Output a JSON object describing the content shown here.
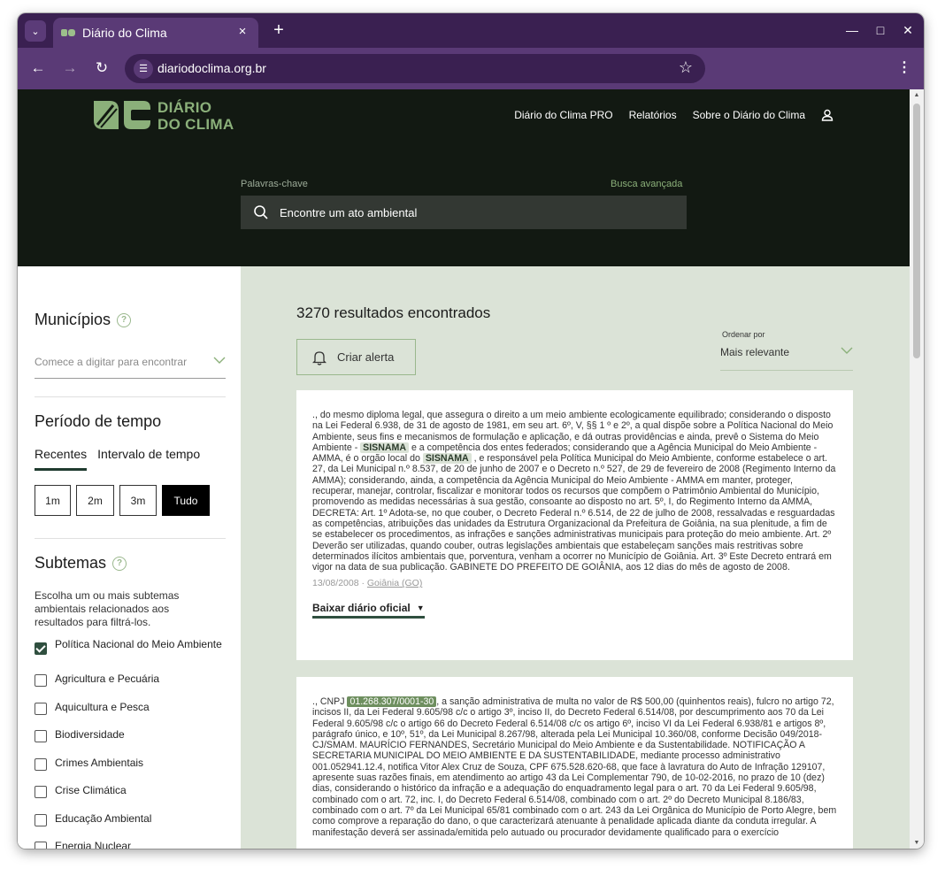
{
  "browser": {
    "tab_title": "Diário do Clima",
    "url": "diariodoclima.org.br",
    "new_tab": "+",
    "close_tab": "×"
  },
  "site": {
    "logo_line1": "DIÁRIO",
    "logo_line2": "DO CLIMA",
    "nav": {
      "pro": "Diário do Clima PRO",
      "reports": "Relatórios",
      "about": "Sobre o Diário do Clima"
    },
    "search": {
      "label": "Palavras-chave",
      "advanced": "Busca avançada",
      "placeholder": "Encontre um ato ambiental"
    }
  },
  "sidebar": {
    "municipios": {
      "title": "Municípios",
      "placeholder": "Comece a digitar para encontrar"
    },
    "periodo": {
      "title": "Período de tempo",
      "tab_recent": "Recentes",
      "tab_interval": "Intervalo de tempo",
      "buttons": [
        "1m",
        "2m",
        "3m",
        "Tudo"
      ],
      "active": "Tudo"
    },
    "subtemas": {
      "title": "Subtemas",
      "description": "Escolha um ou mais subtemas ambientais relacionados aos resultados para filtrá-los.",
      "items": [
        {
          "label": "Política Nacional do Meio Ambiente",
          "checked": true
        },
        {
          "label": "Agricultura e Pecuária",
          "checked": false
        },
        {
          "label": "Aquicultura e Pesca",
          "checked": false
        },
        {
          "label": "Biodiversidade",
          "checked": false
        },
        {
          "label": "Crimes Ambientais",
          "checked": false
        },
        {
          "label": "Crise Climática",
          "checked": false
        },
        {
          "label": "Educação Ambiental",
          "checked": false
        },
        {
          "label": "Energia Nuclear",
          "checked": false
        }
      ]
    }
  },
  "main": {
    "results_count": "3270 resultados encontrados",
    "create_alert": "Criar alerta",
    "sort_label": "Ordenar por",
    "sort_value": "Mais relevante",
    "results": [
      {
        "text_before": "., do mesmo diploma legal, que assegura o direito a um meio ambiente ecologicamente equilibrado; considerando o disposto na Lei Federal 6.938, de 31 de agosto de 1981, em seu art. 6º, V, §§ 1 º e 2º, a qual dispõe sobre a Política Nacional do Meio Ambiente, seus fins e mecanismos de formulação e aplicação, e dá outras providências e ainda, prevê o Sistema do Meio Ambiente - ",
        "highlight1": "SISNAMA",
        "text_middle": " e a competência dos entes federados; considerando que a Agência Municipal do Meio Ambiente - AMMA, é o orgão local do ",
        "highlight2": "SISNAMA",
        "text_after": " , e responsável pela Política Municipal do Meio Ambiente, conforme estabelece o art. 27, da Lei Municipal n.º 8.537, de 20 de junho de 2007 e o Decreto n.º 527, de 29 de fevereiro de 2008 (Regimento Interno da AMMA); considerando, ainda, a competência da Agência Municipal do Meio Ambiente - AMMA em manter, proteger, recuperar, manejar, controlar, fiscalizar e monitorar todos os recursos que compõem o Patrimônio Ambiental do Município, promovendo as medidas necessárias à sua gestão, consoante ao disposto no art. 5º, I, do Regimento Interno da AMMA, DECRETA: Art. 1º Adota-se, no que couber, o Decreto Federal n.º 6.514, de 22 de julho de 2008, ressalvadas e resguardadas as competências, atribuições das unidades da Estrutura Organizacional da Prefeitura de Goiânia, na sua plenitude, a fim de se estabelecer os procedimentos, as infrações e sanções administrativas municipais para proteção do meio ambiente. Art. 2º Deverão ser utilizadas, quando couber, outras legislações ambientais que estabeleçam sanções mais restritivas sobre determinados ilícitos ambientais que, porventura, venham a ocorrer no Município de Goiânia. Art. 3º Este Decreto entrará em vigor na data de sua publicação. GABINETE DO PREFEITO DE GOIÂNIA, aos 12 dias do mês de agosto de 2008.",
        "date": "13/08/2008 · ",
        "city": "Goiânia (GO)",
        "download": "Baixar diário oficial"
      },
      {
        "text_before": "., CNPJ ",
        "highlight1": "01.268.307/0001-30",
        "text_after": ", a sanção administrativa de multa no valor de R$ 500,00 (quinhentos reais), fulcro no artigo 72, incisos II, da Lei Federal 9.605/98 c/c o artigo 3º, inciso II, do Decreto Federal 6.514/08, por descumprimento aos 70 da Lei Federal 9.605/98 c/c o artigo 66 do Decreto Federal 6.514/08 c/c os artigo 6º, inciso VI da Lei Federal 6.938/81 e artigos 8º, parágrafo único, e 10º, 51º, da Lei Municipal 8.267/98, alterada pela Lei Municipal 10.360/08, conforme Decisão 049/2018- CJ/SMAM. MAURÍCIO FERNANDES, Secretário Municipal do Meio Ambiente e da Sustentabilidade. NOTIFICAÇÃO A SECRETARIA MUNICIPAL DO MEIO AMBIENTE E DA SUSTENTABILIDADE, mediante processo administrativo 001.052941.12.4, notifica Vitor Alex Cruz de Souza, CPF 675.528.620-68, que face à lavratura do Auto de Infração 129107, apresente suas razões finais, em atendimento ao artigo 43 da Lei Complementar 790, de 10-02-2016, no prazo de 10 (dez) dias, considerando o histórico da infração e a adequação do enquadramento legal para o art. 70 da Lei Federal 9.605/98, combinado com o art. 72, inc. I, do Decreto Federal 6.514/08, combinado com o art. 2º do Decreto Municipal 8.186/83, combinado com o art. 7º da Lei Municipal 65/81 combinado com o art. 243 da Lei Orgânica do Município de Porto Alegre, bem como comprove a reparação do dano, o que caracterizará atenuante à penalidade aplicada diante da conduta irregular. A manifestação deverá ser assinada/emitida pelo autuado ou procurador devidamente qualificado para o exercício"
      }
    ]
  }
}
